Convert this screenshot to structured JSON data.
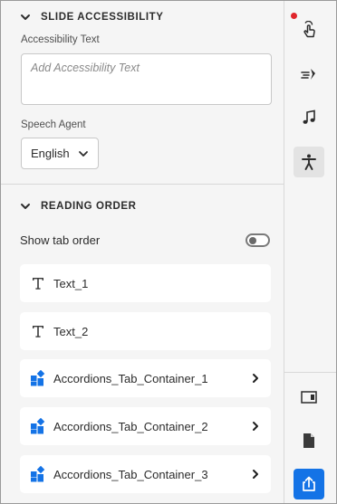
{
  "slide_accessibility": {
    "title": "SLIDE ACCESSIBILITY",
    "accessibility_text_label": "Accessibility Text",
    "accessibility_text_placeholder": "Add Accessibility Text",
    "speech_agent_label": "Speech Agent",
    "speech_agent_value": "English"
  },
  "reading_order": {
    "title": "READING ORDER",
    "show_tab_order_label": "Show tab order",
    "show_tab_order_on": false,
    "items": [
      {
        "label": "Text_1",
        "icon": "text-icon",
        "expandable": false
      },
      {
        "label": "Text_2",
        "icon": "text-icon",
        "expandable": false
      },
      {
        "label": "Accordions_Tab_Container_1",
        "icon": "widget-icon",
        "expandable": true
      },
      {
        "label": "Accordions_Tab_Container_2",
        "icon": "widget-icon",
        "expandable": true
      },
      {
        "label": "Accordions_Tab_Container_3",
        "icon": "widget-icon",
        "expandable": true
      }
    ]
  },
  "rail": {
    "items": [
      {
        "icon": "interaction-icon",
        "has_notification": true
      },
      {
        "icon": "animation-icon"
      },
      {
        "icon": "audio-icon"
      },
      {
        "icon": "accessibility-icon",
        "active": true
      },
      {
        "icon": "properties-icon"
      },
      {
        "icon": "document-icon"
      },
      {
        "icon": "publish-icon",
        "primary": true
      }
    ]
  },
  "colors": {
    "accent": "#1473e6",
    "notification": "#e0252c",
    "panel_bg": "#f5f5f5"
  }
}
